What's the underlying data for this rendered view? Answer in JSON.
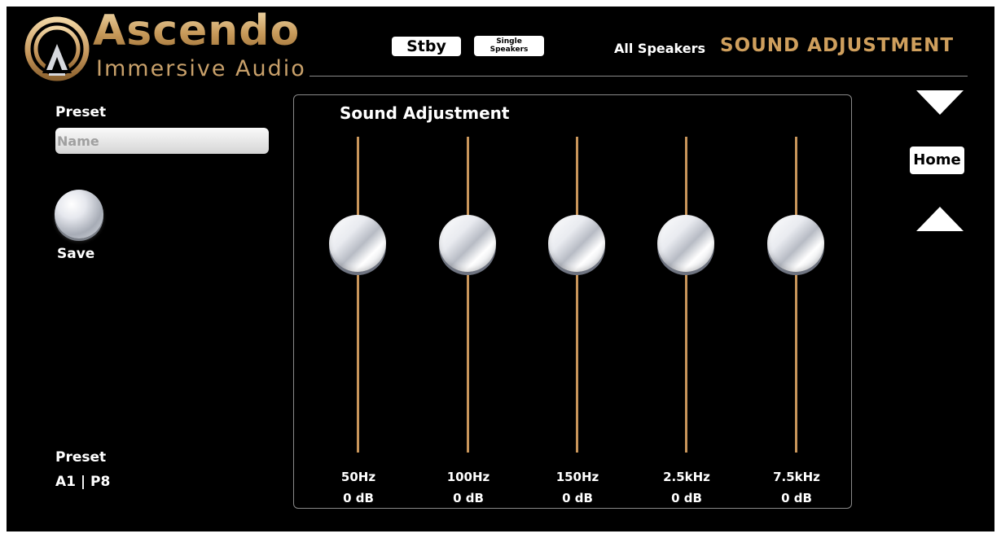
{
  "brand": {
    "name": "Ascendo",
    "tagline": "Immersive Audio"
  },
  "header": {
    "stby_label": "Stby",
    "single_speakers_line1": "Single",
    "single_speakers_line2": "Speakers",
    "speaker_mode": "All Speakers",
    "screen_title": "SOUND ADJUSTMENT"
  },
  "preset_editor": {
    "label": "Preset",
    "name_placeholder": "Name",
    "name_value": "",
    "save_label": "Save"
  },
  "current_preset": {
    "label": "Preset",
    "value": "A1 | P8"
  },
  "sound_adjustment": {
    "title": "Sound Adjustment",
    "bands": [
      {
        "freq": "50Hz",
        "gain": "0 dB",
        "gain_db": 0
      },
      {
        "freq": "100Hz",
        "gain": "0 dB",
        "gain_db": 0
      },
      {
        "freq": "150Hz",
        "gain": "0 dB",
        "gain_db": 0
      },
      {
        "freq": "2.5kHz",
        "gain": "0 dB",
        "gain_db": 0
      },
      {
        "freq": "7.5kHz",
        "gain": "0 dB",
        "gain_db": 0
      }
    ]
  },
  "nav": {
    "home_label": "Home",
    "scroll_down_icon": "triangle-down-icon",
    "scroll_up_icon": "triangle-up-icon"
  },
  "colors": {
    "accent_gold": "#cf9f5d",
    "slider_track": "#c8955a",
    "background": "#000000"
  }
}
